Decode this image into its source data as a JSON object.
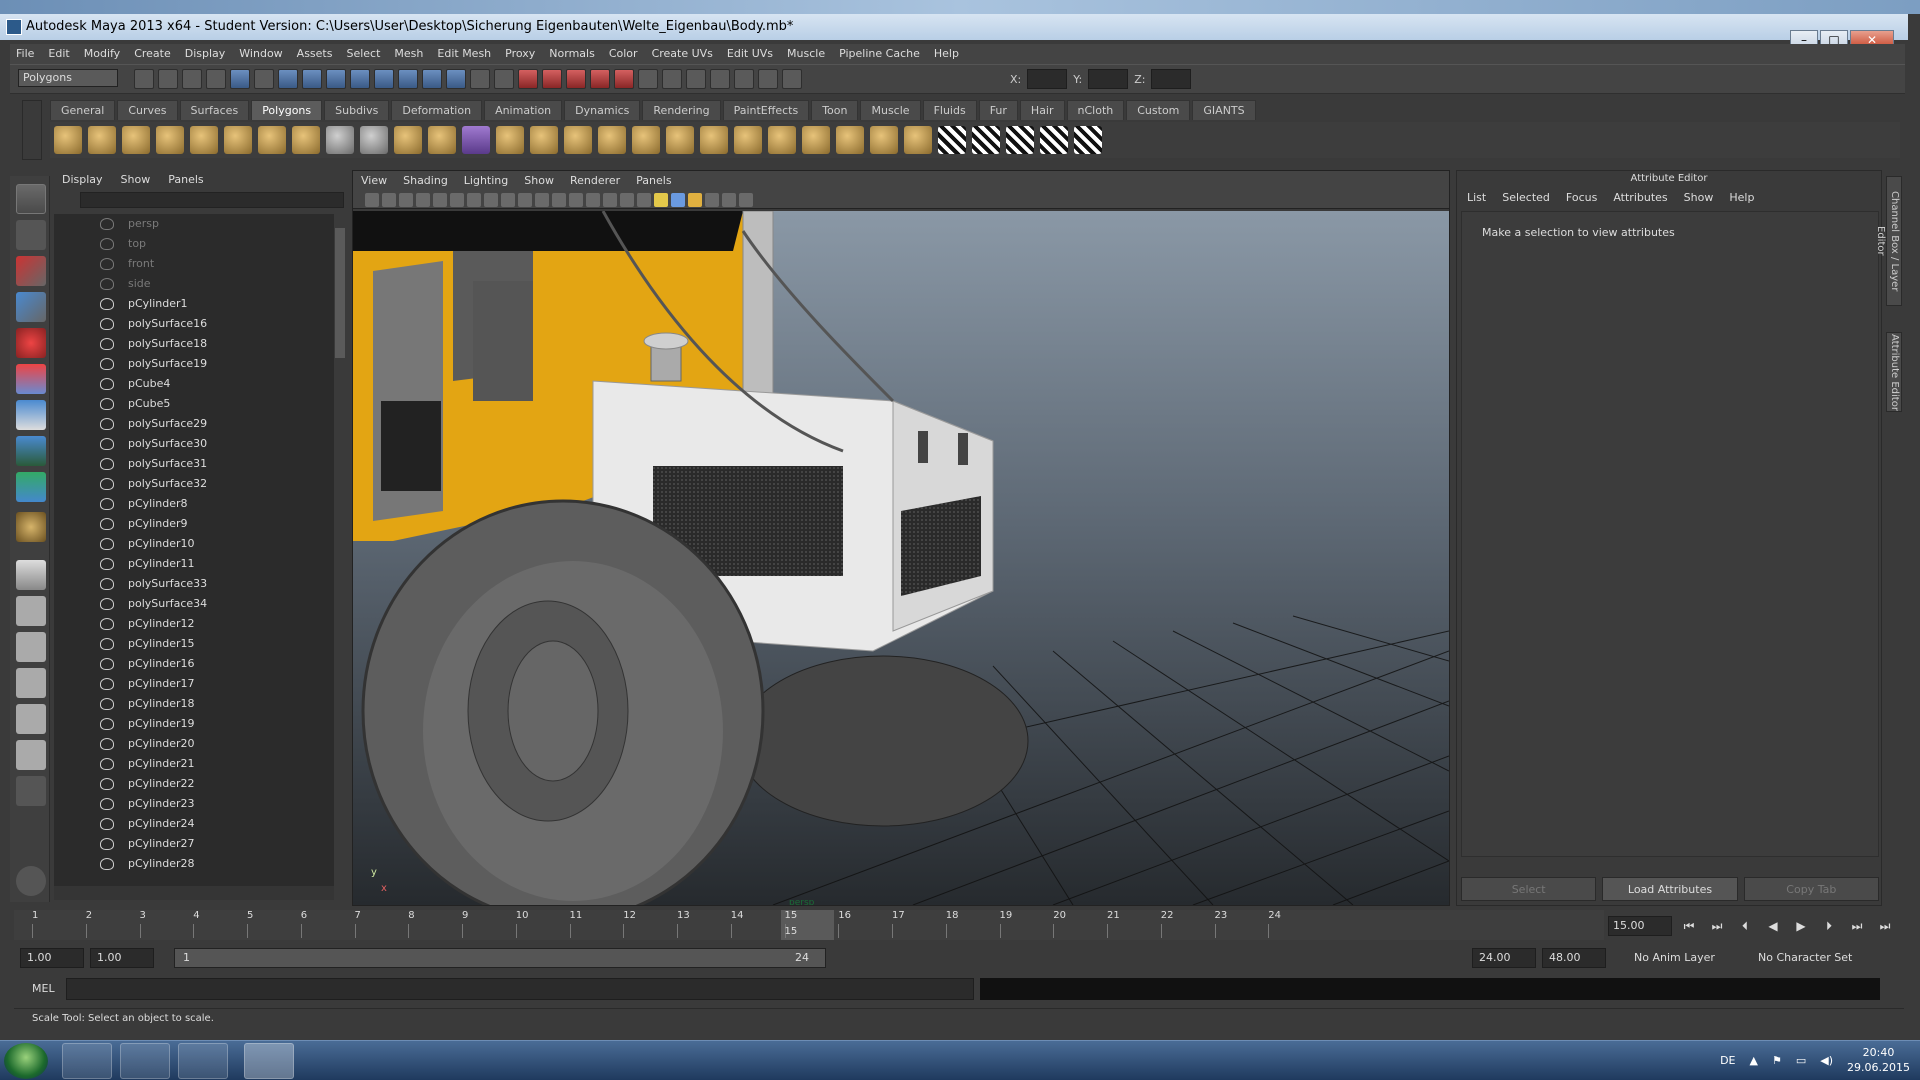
{
  "window": {
    "title": "Autodesk Maya 2013 x64 - Student Version: C:\\Users\\User\\Desktop\\Sicherung Eigenbauten\\Welte_Eigenbau\\Body.mb*",
    "minimize": "–",
    "maximize": "□",
    "close": "✕"
  },
  "menubar": [
    "File",
    "Edit",
    "Modify",
    "Create",
    "Display",
    "Window",
    "Assets",
    "Select",
    "Mesh",
    "Edit Mesh",
    "Proxy",
    "Normals",
    "Color",
    "Create UVs",
    "Edit UVs",
    "Muscle",
    "Pipeline Cache",
    "Help"
  ],
  "statusline": {
    "mode": "Polygons",
    "x_label": "X:",
    "y_label": "Y:",
    "z_label": "Z:"
  },
  "shelf": {
    "tabs": [
      "General",
      "Curves",
      "Surfaces",
      "Polygons",
      "Subdivs",
      "Deformation",
      "Animation",
      "Dynamics",
      "Rendering",
      "PaintEffects",
      "Toon",
      "Muscle",
      "Fluids",
      "Fur",
      "Hair",
      "nCloth",
      "Custom",
      "GIANTS"
    ],
    "active_tab": "Polygons"
  },
  "outliner": {
    "menu": [
      "Display",
      "Show",
      "Panels"
    ],
    "items": [
      {
        "name": "persp",
        "type": "camera"
      },
      {
        "name": "top",
        "type": "camera"
      },
      {
        "name": "front",
        "type": "camera"
      },
      {
        "name": "side",
        "type": "camera"
      },
      {
        "name": "pCylinder1",
        "type": "mesh"
      },
      {
        "name": "polySurface16",
        "type": "mesh"
      },
      {
        "name": "polySurface18",
        "type": "mesh"
      },
      {
        "name": "polySurface19",
        "type": "mesh"
      },
      {
        "name": "pCube4",
        "type": "mesh"
      },
      {
        "name": "pCube5",
        "type": "mesh"
      },
      {
        "name": "polySurface29",
        "type": "mesh"
      },
      {
        "name": "polySurface30",
        "type": "mesh"
      },
      {
        "name": "polySurface31",
        "type": "mesh"
      },
      {
        "name": "polySurface32",
        "type": "mesh"
      },
      {
        "name": "pCylinder8",
        "type": "mesh"
      },
      {
        "name": "pCylinder9",
        "type": "mesh"
      },
      {
        "name": "pCylinder10",
        "type": "mesh"
      },
      {
        "name": "pCylinder11",
        "type": "mesh"
      },
      {
        "name": "polySurface33",
        "type": "mesh"
      },
      {
        "name": "polySurface34",
        "type": "mesh"
      },
      {
        "name": "pCylinder12",
        "type": "mesh"
      },
      {
        "name": "pCylinder15",
        "type": "mesh"
      },
      {
        "name": "pCylinder16",
        "type": "mesh"
      },
      {
        "name": "pCylinder17",
        "type": "mesh"
      },
      {
        "name": "pCylinder18",
        "type": "mesh"
      },
      {
        "name": "pCylinder19",
        "type": "mesh"
      },
      {
        "name": "pCylinder20",
        "type": "mesh"
      },
      {
        "name": "pCylinder21",
        "type": "mesh"
      },
      {
        "name": "pCylinder22",
        "type": "mesh"
      },
      {
        "name": "pCylinder23",
        "type": "mesh"
      },
      {
        "name": "pCylinder24",
        "type": "mesh"
      },
      {
        "name": "pCylinder27",
        "type": "mesh"
      },
      {
        "name": "pCylinder28",
        "type": "mesh"
      }
    ]
  },
  "viewport": {
    "menu": [
      "View",
      "Shading",
      "Lighting",
      "Show",
      "Renderer",
      "Panels"
    ],
    "camera_label": "persp",
    "axis_y": "y",
    "axis_x": "x"
  },
  "attribute_editor": {
    "title": "Attribute Editor",
    "menu": [
      "List",
      "Selected",
      "Focus",
      "Attributes",
      "Show",
      "Help"
    ],
    "message": "Make a selection to view attributes",
    "buttons": [
      "Select",
      "Load Attributes",
      "Copy Tab"
    ],
    "side_tabs": [
      "Channel Box / Layer Editor",
      "Attribute Editor"
    ]
  },
  "timeline": {
    "ticks": [
      "1",
      "2",
      "3",
      "4",
      "5",
      "6",
      "7",
      "8",
      "9",
      "10",
      "11",
      "12",
      "13",
      "14",
      "15",
      "16",
      "17",
      "18",
      "19",
      "20",
      "21",
      "22",
      "23",
      "24"
    ],
    "current_frame": "15",
    "current_frame_field": "15.00"
  },
  "range": {
    "start_time": "1.00",
    "playback_start": "1.00",
    "range_start": "1",
    "range_end": "24",
    "playback_end": "24.00",
    "end_time": "48.00",
    "anim_layer": "No Anim Layer",
    "character_set": "No Character Set"
  },
  "command_line": {
    "label": "MEL"
  },
  "help_line": "Scale Tool: Select an object to scale.",
  "taskbar": {
    "language": "DE",
    "time": "20:40",
    "date": "29.06.2015"
  },
  "colors": {
    "ui_bg": "#444444",
    "panel_bg": "#2b2b2b",
    "viewport_bg_top": "#8a9aaa",
    "viewport_bg_bottom": "#2e3338",
    "cab_yellow": "#e8a912",
    "hood_white": "#efefef",
    "tire_gray": "#6e6e6e"
  }
}
